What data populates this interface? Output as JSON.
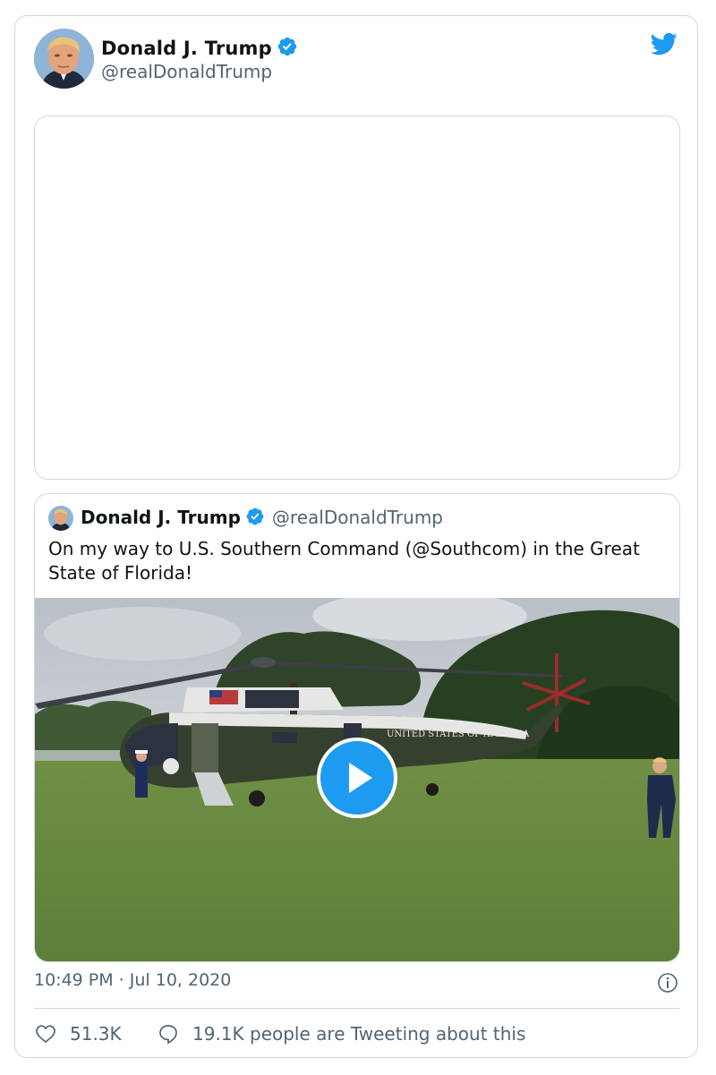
{
  "tweet": {
    "author_name": "Donald J. Trump",
    "author_handle": "@realDonaldTrump",
    "timestamp": "10:49 PM · Jul 10, 2020",
    "likes": "51.3K",
    "conversation": "19.1K people are Tweeting about this"
  },
  "quoted": {
    "author_name": "Donald J. Trump",
    "author_handle": "@realDonaldTrump",
    "text": "On my way to U.S. Southern Command (@Southcom) in the Great State of Florida!",
    "helicopter_text": "UNITED STATES OF AMERICA"
  },
  "colors": {
    "twitter_blue": "#1d9bf0",
    "secondary_text": "#536471",
    "border": "#cfd9de"
  },
  "icons": [
    "twitter-bird-icon",
    "verified-badge-icon",
    "play-icon",
    "info-icon",
    "heart-icon",
    "speech-bubble-icon"
  ]
}
